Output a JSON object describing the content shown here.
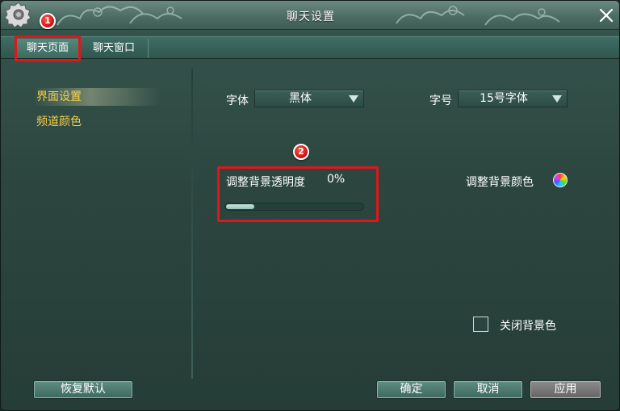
{
  "window": {
    "title": "聊天设置"
  },
  "tabs": [
    {
      "label": "聊天页面",
      "active": true
    },
    {
      "label": "聊天窗口",
      "active": false
    }
  ],
  "annotations": {
    "badge1": "1",
    "badge2": "2",
    "color": "#e0161a"
  },
  "sidebar": {
    "items": [
      {
        "label": "界面设置",
        "active": true
      },
      {
        "label": "频道颜色",
        "active": false
      }
    ]
  },
  "settings": {
    "font_label": "字体",
    "font_value": "黑体",
    "size_label": "字号",
    "size_value": "15号字体",
    "opacity_label": "调整背景透明度",
    "opacity_value": "0%",
    "opacity_fill_fraction": 0.21,
    "bgcolor_label": "调整背景颜色",
    "close_bg_label": "关闭背景色",
    "close_bg_checked": false
  },
  "buttons": {
    "restore_default": "恢复默认",
    "ok": "确定",
    "cancel": "取消",
    "apply": "应用"
  },
  "colors": {
    "sidebar_text": "#f2d04a",
    "accent": "#3f6a5f",
    "apply_disabled": "#777777"
  }
}
